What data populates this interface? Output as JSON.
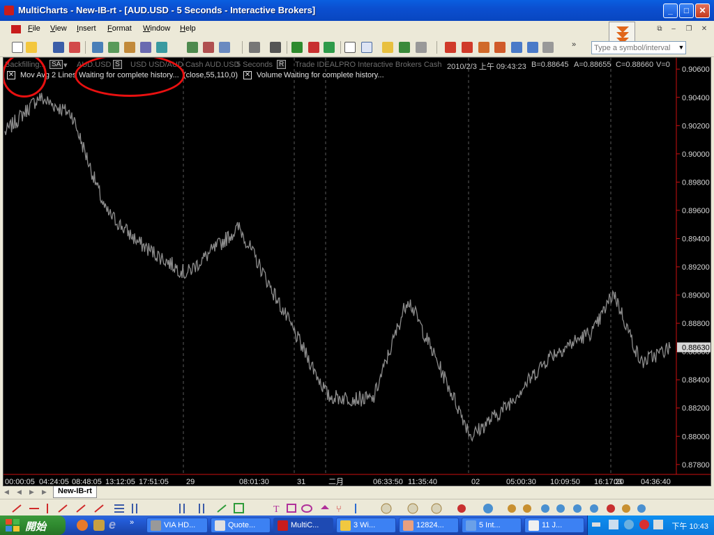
{
  "window": {
    "title": "MultiCharts - New-IB-rt - [AUD.USD - 5 Seconds - Interactive Brokers]",
    "controls": [
      "_",
      "□",
      "✕"
    ]
  },
  "menu": [
    "File",
    "View",
    "Insert",
    "Format",
    "Window",
    "Help"
  ],
  "toolbar": {
    "symbol_placeholder": "Type a symbol/interval",
    "alert_icon": "double-chevron-down-icon"
  },
  "chart": {
    "status": {
      "mode": "Backfilling...",
      "sa_label": "SA",
      "symbol": "AUD.USD",
      "s_label": "S",
      "description": "USD USD/AUD Cash AUD.USD",
      "interval": "5 Seconds",
      "r_label": "R",
      "exchange": "Trade IDEALPRO Interactive Brokers Cash",
      "datetime": "2010/2/3 上午 09:43:23",
      "bid": "B=0.88645",
      "ask": "A=0.88655",
      "close": "C=0.88660",
      "volume": "V=0"
    },
    "indicators": [
      {
        "name": "Mov Avg 2 Lines",
        "message": "Waiting for complete history...",
        "params": "(close,55,110,0)"
      },
      {
        "name": "Volume",
        "message": "Waiting for complete history..."
      }
    ],
    "last_price": "0.88630",
    "colors": {
      "price": "#8c8c8c",
      "axis": "#cc1111",
      "annotation": "#e81010",
      "last_price_bg": "#d8d8d8"
    }
  },
  "chart_data": {
    "type": "line",
    "ylim": [
      0.8773,
      0.9068
    ],
    "y_ticks": [
      "0.90600",
      "0.90400",
      "0.90200",
      "0.90000",
      "0.89800",
      "0.89600",
      "0.89400",
      "0.89200",
      "0.89000",
      "0.88800",
      "0.88600",
      "0.88400",
      "0.88200",
      "0.88000",
      "0.87800"
    ],
    "x_ticks": [
      "00:00:05",
      "04:24:05",
      "08:48:05",
      "13:12:05",
      "17:51:05",
      "29",
      "08:01:30",
      "31",
      "二月",
      "06:33:50",
      "11:35:40",
      "02",
      "05:00:30",
      "10:09:50",
      "16:17:20",
      "03",
      "04:36:40"
    ],
    "series": [
      {
        "x": [
          "00:00:05",
          "04:24:05",
          "08:48:05",
          "13:12:05",
          "17:51:05",
          "29",
          "08:01:30",
          "31",
          "二月",
          "06:33:50",
          "11:35:40",
          "02",
          "05:00:30",
          "10:09:50",
          "16:17:20",
          "03",
          "04:36:40"
        ],
        "values": [
          0.9015,
          0.904,
          0.9028,
          0.896,
          0.8937,
          0.8915,
          0.8948,
          0.887,
          0.8828,
          0.8826,
          0.8898,
          0.88,
          0.8821,
          0.8857,
          0.8875,
          0.8902,
          0.8852
        ]
      }
    ],
    "grid": "vertical dashed session separators"
  },
  "sheet_tab": "New-IB-rt",
  "taskbar": {
    "start_label": "開始",
    "tasks": [
      "VIA HD...",
      "Quote...",
      "MultiC...",
      "3 Wi...",
      "12824...",
      "5 Int...",
      "11 J..."
    ],
    "clock": "下午 10:43"
  }
}
